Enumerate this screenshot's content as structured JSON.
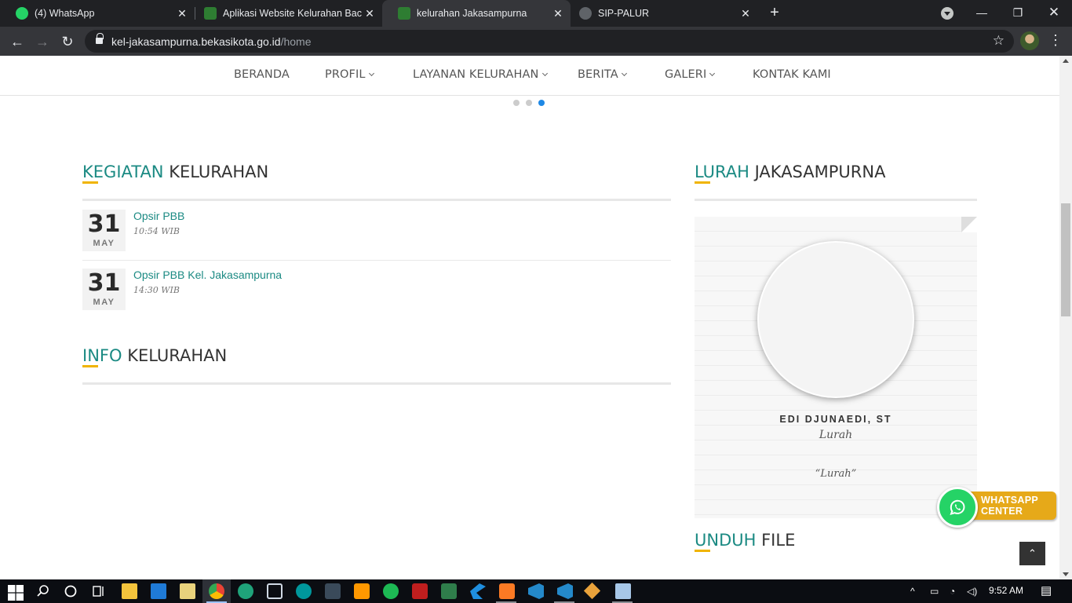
{
  "browser": {
    "tabs": [
      {
        "title": "(4) WhatsApp",
        "active": false,
        "icon": "whatsapp-icon",
        "color": "#25d366"
      },
      {
        "title": "Aplikasi Website Kelurahan Backe",
        "active": false,
        "icon": "bekasi-logo-icon",
        "color": "#2e7d32"
      },
      {
        "title": "kelurahan Jakasampurna",
        "active": true,
        "icon": "bekasi-logo-icon",
        "color": "#2e7d32"
      },
      {
        "title": "SIP-PALUR",
        "active": false,
        "icon": "globe-icon",
        "color": "#5f6368"
      }
    ],
    "url_host": "kel-jakasampurna.bekasikota.go.id",
    "url_path": "/home"
  },
  "site_nav": {
    "items": [
      {
        "label": "BERANDA",
        "dropdown": false
      },
      {
        "label": "PROFIL",
        "dropdown": true
      },
      {
        "label": "LAYANAN KELURAHAN",
        "dropdown": true
      },
      {
        "label": "BERITA",
        "dropdown": true
      },
      {
        "label": "GALERI",
        "dropdown": true
      },
      {
        "label": "KONTAK KAMI",
        "dropdown": false
      }
    ]
  },
  "slider": {
    "dot_count": 3,
    "active_index": 2
  },
  "kegiatan": {
    "title_highlight": "KEGIATAN",
    "title_rest": " KELURAHAN",
    "events": [
      {
        "day": "31",
        "month": "MAY",
        "title": "Opsir PBB",
        "time": "10:54 WIB"
      },
      {
        "day": "31",
        "month": "MAY",
        "title": "Opsir PBB Kel. Jakasampurna",
        "time": "14:30 WIB"
      }
    ]
  },
  "info": {
    "title_highlight": "INFO",
    "title_rest": " KELURAHAN"
  },
  "lurah": {
    "title_highlight": "LURAH",
    "title_rest": " JAKASAMPURNA",
    "name": "EDI DJUNAEDI, ST",
    "role": "Lurah",
    "quote": "“Lurah”"
  },
  "unduh": {
    "title_highlight": "UNDUH",
    "title_rest": " FILE"
  },
  "whatsapp_center": {
    "line1": "WHATSAPP",
    "line2": "CENTER"
  },
  "taskbar": {
    "time": "9:52 AM"
  },
  "colors": {
    "accent": "#1b8a83",
    "underline": "#f0b400",
    "whatsapp": "#25d366",
    "wa_banner": "#e6a919"
  }
}
